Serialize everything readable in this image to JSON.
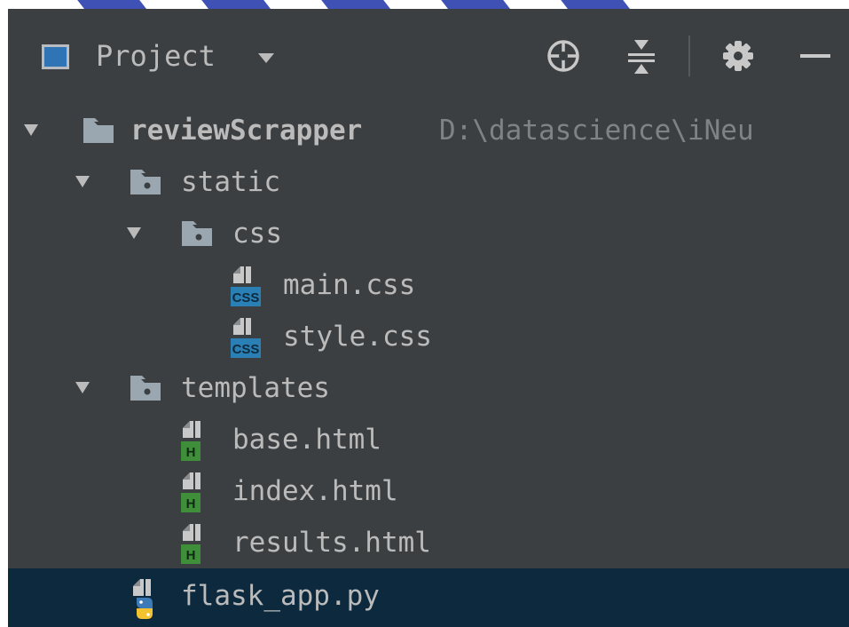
{
  "panel": {
    "title": "Project"
  },
  "tree": [
    {
      "label": "reviewScrapper",
      "path": "D:\\datascience\\iNeu",
      "type": "root-folder",
      "expanded": true
    },
    {
      "label": "static",
      "type": "folder",
      "expanded": true
    },
    {
      "label": "css",
      "type": "folder",
      "expanded": true
    },
    {
      "label": "main.css",
      "type": "css-file",
      "badge": "CSS"
    },
    {
      "label": "style.css",
      "type": "css-file",
      "badge": "CSS"
    },
    {
      "label": "templates",
      "type": "folder",
      "expanded": true
    },
    {
      "label": "base.html",
      "type": "html-file",
      "badge": "H"
    },
    {
      "label": "index.html",
      "type": "html-file",
      "badge": "H"
    },
    {
      "label": "results.html",
      "type": "html-file",
      "badge": "H"
    },
    {
      "label": "flask_app.py",
      "type": "python-file",
      "selected": true
    }
  ],
  "colors": {
    "background": "#3c3f41",
    "selection": "#0d293e",
    "text": "#bbbbbb",
    "path_text": "#7f8386",
    "css_badge": "#2a7fb5",
    "html_badge": "#3f8f3a",
    "watermark": "#3f51b5"
  }
}
